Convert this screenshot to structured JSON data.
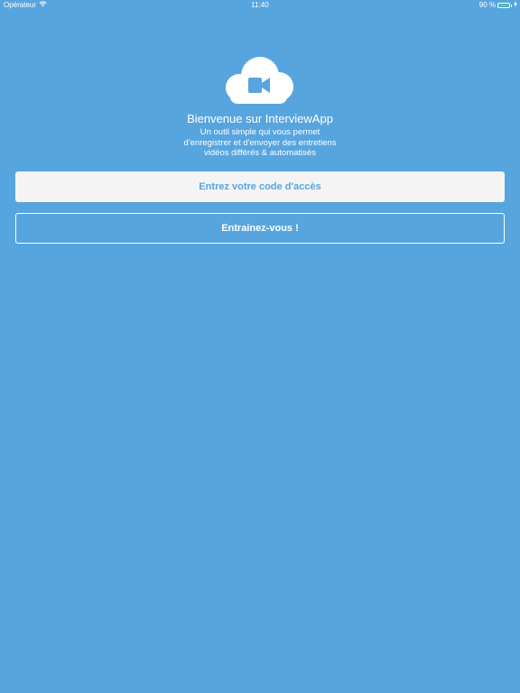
{
  "status_bar": {
    "carrier": "Opérateur",
    "time": "11:40",
    "battery": "90 %",
    "battery_level": 0.9
  },
  "welcome": {
    "title": "Bienvenue sur InterviewApp",
    "subtitle_lines": [
      "Un outil simple qui vous permet",
      "d'enregistrer et d'envoyer des entretiens",
      "vidéos différés & automatisés"
    ]
  },
  "buttons": {
    "access_code": "Entrez votre code d'accès",
    "train": "Entrainez-vous !"
  },
  "icons": {
    "logo": "cloud-video-camera-icon",
    "wifi": "wifi-icon",
    "battery": "battery-icon",
    "charging": "charging-icon"
  },
  "colors": {
    "background": "#57a5de",
    "primary_button_bg": "#f4f4f4",
    "primary_button_text": "#57a5de",
    "text": "#ffffff",
    "battery_fill": "#4cd964"
  }
}
